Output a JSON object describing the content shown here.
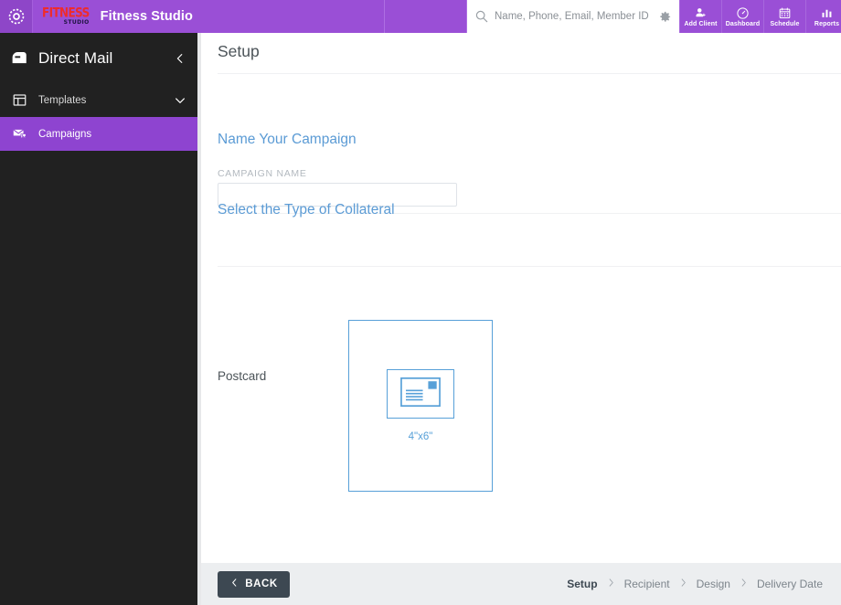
{
  "topbar": {
    "app_logo_icon": "circular-dotted-logo",
    "studio_logo_line1": "FITNESS",
    "studio_logo_line2": "STUDIO",
    "brand_title": "Fitness Studio",
    "logo_red": "#ef2b2b",
    "bar_purple": "#9a4fd6"
  },
  "search": {
    "icon": "search-icon",
    "placeholder": "Name, Phone, Email, Member ID",
    "value": "",
    "settings_icon": "gear-icon"
  },
  "topnav": [
    {
      "label": "Add Client",
      "icon": "add-client-icon"
    },
    {
      "label": "Dashboard",
      "icon": "dashboard-gauge-icon"
    },
    {
      "label": "Schedule",
      "icon": "calendar-icon"
    },
    {
      "label": "Reports",
      "icon": "bar-chart-icon"
    }
  ],
  "sidebar": {
    "header": {
      "label": "Direct Mail",
      "icon": "mailbox-icon",
      "collapse_icon": "chevron-left-icon"
    },
    "items": [
      {
        "label": "Templates",
        "icon": "templates-layout-icon",
        "expand_icon": "chevron-down-icon",
        "active": false
      },
      {
        "label": "Campaigns",
        "icon": "campaigns-mail-icon",
        "active": true
      }
    ],
    "active_color": "#8e44d0",
    "background": "#212121"
  },
  "main": {
    "page_title": "Setup",
    "section_name_campaign": "Name Your Campaign",
    "campaign_name_label": "CAMPAIGN NAME",
    "campaign_name_value": "",
    "campaign_name_placeholder": "",
    "section_collateral": "Select the Type of Collateral",
    "accent_blue": "#57a0d8",
    "collateral": {
      "name": "Postcard",
      "size": "4\"x6\"",
      "icon": "postcard-icon",
      "selected": true
    }
  },
  "footer": {
    "back_label": "BACK",
    "back_icon": "chevron-left-icon",
    "breadcrumbs": [
      {
        "label": "Setup",
        "current": true
      },
      {
        "label": "Recipient",
        "current": false
      },
      {
        "label": "Design",
        "current": false
      },
      {
        "label": "Delivery Date",
        "current": false
      }
    ],
    "separator": "›",
    "background": "#eceef0"
  }
}
